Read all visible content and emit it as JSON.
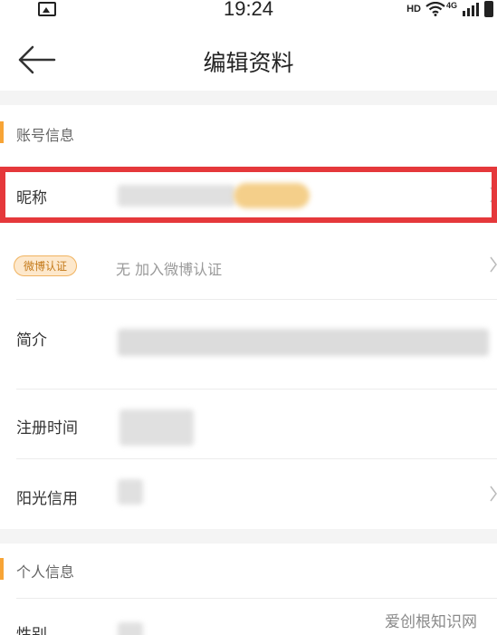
{
  "status_bar": {
    "time": "19:24",
    "hd_label": "HD",
    "network_label": "4G"
  },
  "nav": {
    "title": "编辑资料",
    "back_icon": "back-arrow-icon"
  },
  "account_section": {
    "title": "账号信息",
    "nickname_label": "昵称",
    "weibo_badge": "微博认证",
    "weibo_value": "无 加入微博认证",
    "intro_label": "简介",
    "register_label": "注册时间",
    "credit_label": "阳光信用"
  },
  "personal_section": {
    "title": "个人信息",
    "gender_label": "性别"
  },
  "watermark": "爱创根知识网",
  "colors": {
    "accent": "#f7a436",
    "highlight": "#e5383b",
    "divider": "#ececec",
    "section_bg": "#f4f4f4"
  }
}
